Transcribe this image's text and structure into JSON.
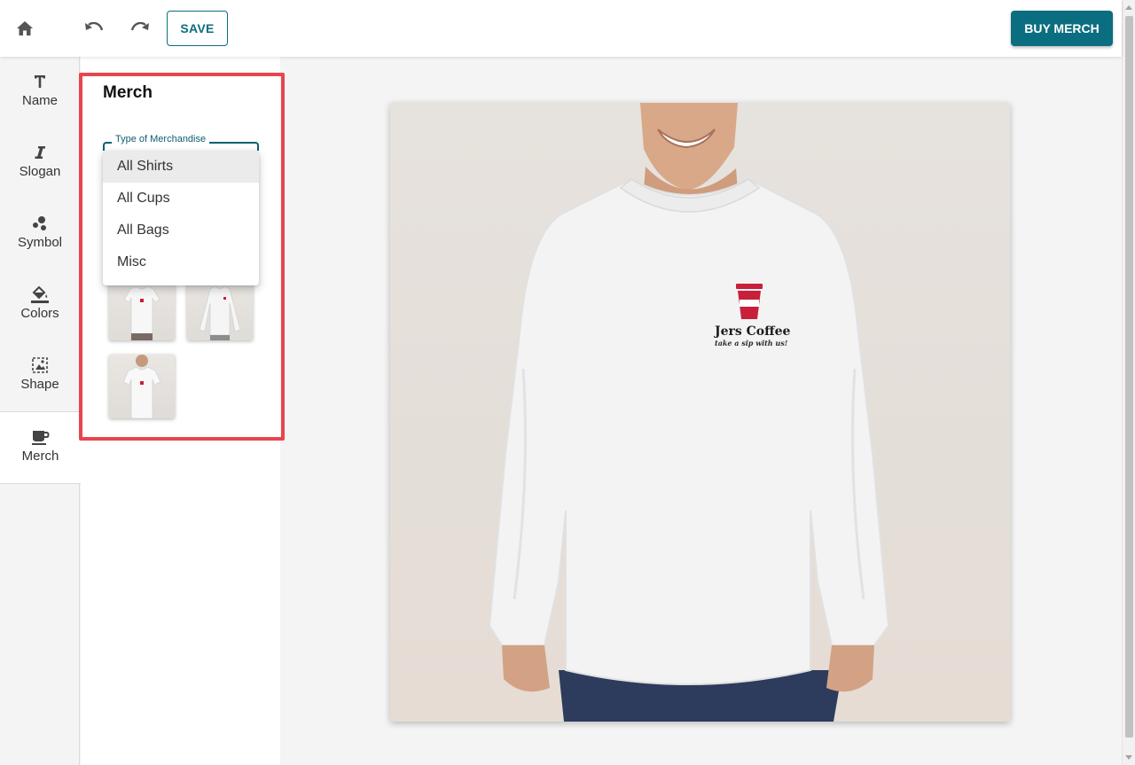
{
  "toolbar": {
    "save_label": "SAVE",
    "buy_label": "BUY MERCH"
  },
  "nav": {
    "items": [
      {
        "label": "Name",
        "icon": "text-icon"
      },
      {
        "label": "Slogan",
        "icon": "italic-icon"
      },
      {
        "label": "Symbol",
        "icon": "symbol-icon"
      },
      {
        "label": "Colors",
        "icon": "paint-bucket-icon"
      },
      {
        "label": "Shape",
        "icon": "image-shape-icon"
      },
      {
        "label": "Merch",
        "icon": "mug-icon"
      }
    ],
    "active": "Merch"
  },
  "panel": {
    "title": "Merch",
    "select_label": "Type of Merchandise",
    "options": [
      "All Shirts",
      "All Cups",
      "All Bags",
      "Misc"
    ],
    "highlighted_option": "All Shirts"
  },
  "preview": {
    "brand_name": "Jers Coffee",
    "slogan": "take a sip with us!",
    "logo_color": "#c8203a"
  },
  "colors": {
    "accent": "#0b6e80",
    "highlight_border": "#e8454e"
  }
}
